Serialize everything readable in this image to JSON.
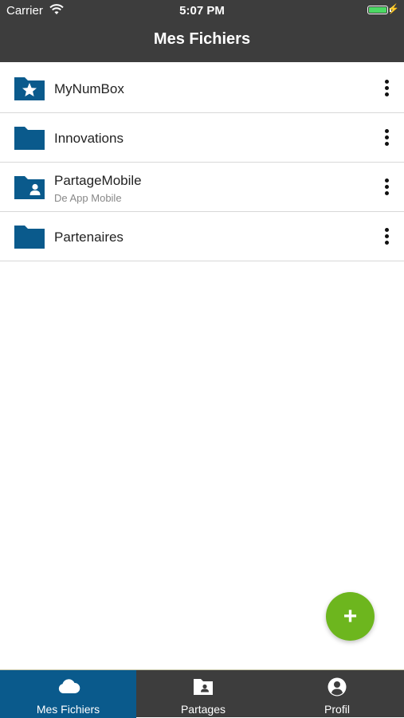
{
  "status_bar": {
    "carrier": "Carrier",
    "time": "5:07 PM",
    "battery_level": 1.0
  },
  "header": {
    "title": "Mes Fichiers"
  },
  "folders": [
    {
      "name": "MyNumBox",
      "subtitle": "",
      "icon": "folder-star-icon"
    },
    {
      "name": "Innovations",
      "subtitle": "",
      "icon": "folder-icon"
    },
    {
      "name": "PartageMobile",
      "subtitle": "De App Mobile",
      "icon": "folder-shared-user-icon"
    },
    {
      "name": "Partenaires",
      "subtitle": "",
      "icon": "folder-icon"
    }
  ],
  "fab": {
    "label": "+",
    "color": "#6db61e"
  },
  "tabs": [
    {
      "label": "Mes Fichiers",
      "icon": "cloud-icon",
      "active": true
    },
    {
      "label": "Partages",
      "icon": "shared-folder-icon",
      "active": false
    },
    {
      "label": "Profil",
      "icon": "profile-icon",
      "active": false
    }
  ],
  "colors": {
    "header_bg": "#3d3d3d",
    "folder_blue": "#0a5a8c",
    "active_tab": "#0a5a8c",
    "accent_green": "#6db61e"
  }
}
